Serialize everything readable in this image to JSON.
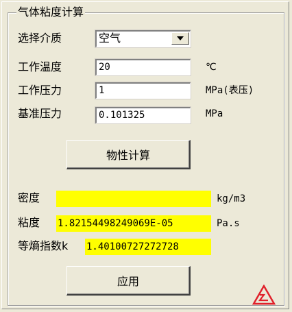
{
  "group_title": "气体粘度计算",
  "medium": {
    "label": "选择介质",
    "selected": "空气"
  },
  "temperature": {
    "label": "工作温度",
    "value": "20",
    "unit": "℃"
  },
  "pressure": {
    "label": "工作压力",
    "value": "1",
    "unit": "MPa(表压)"
  },
  "reference_pressure": {
    "label": "基准压力",
    "value": "0.101325",
    "unit": "MPa"
  },
  "calc_button_label": "物性计算",
  "density": {
    "label": "密度",
    "value": "",
    "unit": "kg/m3"
  },
  "viscosity": {
    "label": "粘度",
    "value": "1.82154498249069E-05",
    "unit": "Pa.s"
  },
  "isentropic": {
    "label": "等熵指数k",
    "value": "1.40100727272728"
  },
  "apply_button_label": "应用",
  "colors": {
    "result_bg": "#ffff00",
    "panel_bg": "#ece9d8",
    "logo_red": "#e0202a"
  },
  "icons": {
    "dropdown": "chevron-down-icon",
    "logo": "company-logo"
  }
}
